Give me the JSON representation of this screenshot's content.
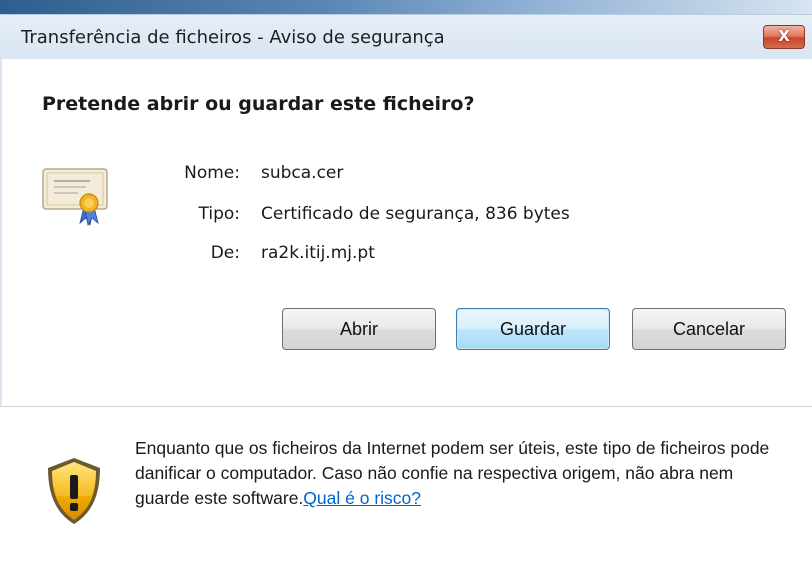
{
  "window": {
    "title": "Transferência de ficheiros - Aviso de segurança",
    "close_label": "X"
  },
  "dialog": {
    "question": "Pretende abrir ou guardar este ficheiro?",
    "file_icon": "certificate-icon",
    "fields": [
      {
        "label": "Nome:",
        "value": "subca.cer"
      },
      {
        "label": "Tipo:",
        "value": "Certificado de segurança, 836 bytes"
      },
      {
        "label": "De:",
        "value": "ra2k.itij.mj.pt"
      }
    ],
    "buttons": {
      "open": "Abrir",
      "save": "Guardar",
      "cancel": "Cancelar"
    }
  },
  "footer": {
    "icon": "warning-shield-icon",
    "warning_text": "Enquanto que os ficheiros da Internet podem ser úteis, este tipo de ficheiros pode danificar o computador. Caso não confie na respectiva origem, não abra nem guarde este software.",
    "risk_link": "Qual é o risco?"
  },
  "colors": {
    "link": "#0066cc",
    "close_button": "#c8472a",
    "default_button_border": "#3c7fb1"
  }
}
